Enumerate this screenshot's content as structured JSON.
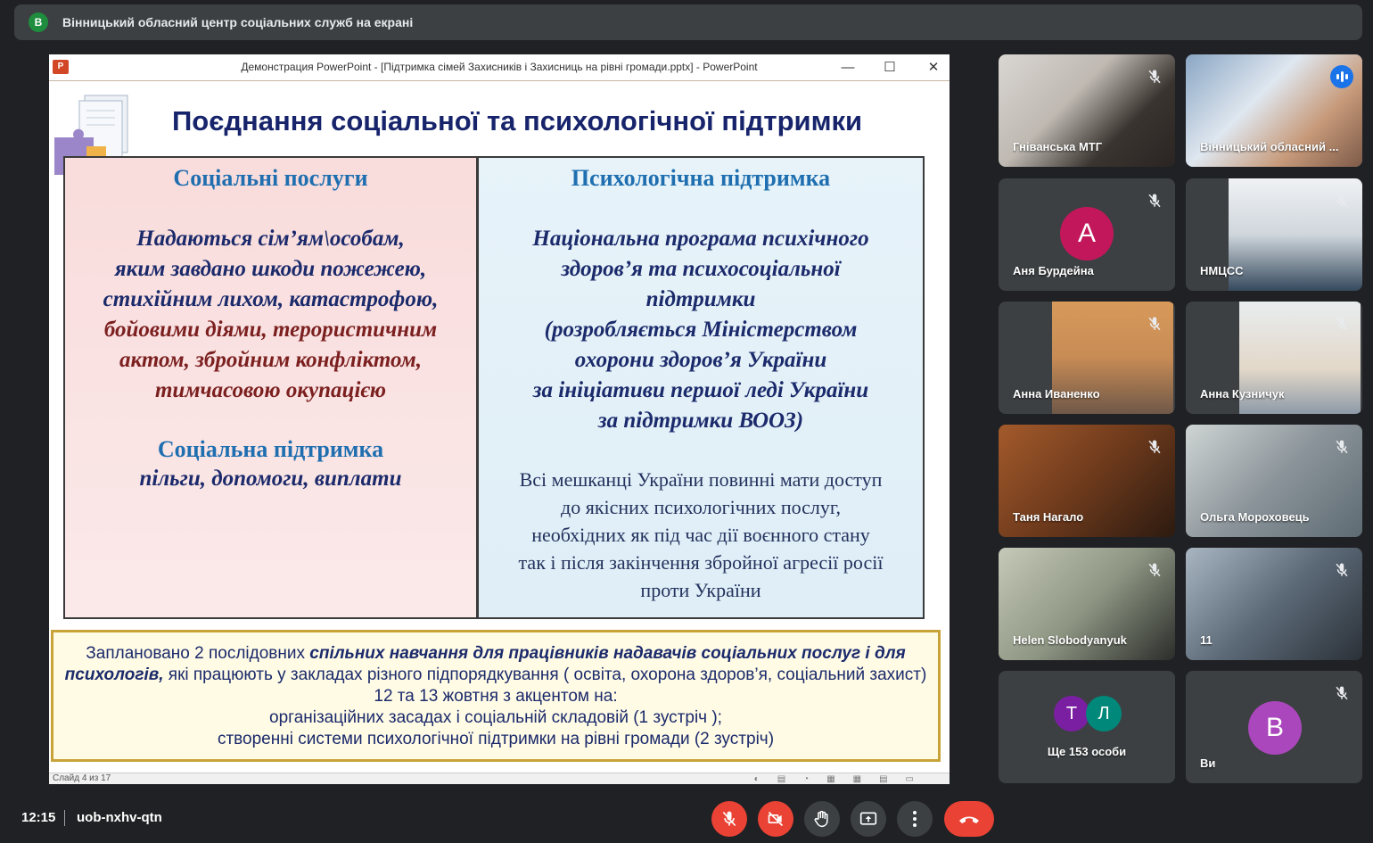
{
  "banner": {
    "avatar_letter": "В",
    "text": "Вінницький обласний центр соціальних служб на екрані"
  },
  "ppt_window": {
    "title": "Демонстрация PowerPoint - [Підтримка сімей  Захисників і Захисниць на рівні громади.pptx] - PowerPoint",
    "icon_label": "P",
    "minimize": "—",
    "maximize": "☐",
    "close": "✕"
  },
  "slide": {
    "title": "Поєднання соціальної та психологічної підтримки",
    "left": {
      "header": "Соціальні послуги",
      "line1": "Надаються сім’ям\\особам,",
      "line2": "яким завдано шкоди пожежею,",
      "line3": "стихійним лихом, катастрофою,",
      "line4": "бойовими діями, терористичним",
      "line5": "актом, збройним конфліктом,",
      "line6": "тимчасовою окупацією",
      "sub_header": "Соціальна підтримка",
      "sub_text": "пільги, допомоги, виплати"
    },
    "right": {
      "header": "Психологічна підтримка",
      "line1": "Національна програма психічного",
      "line2": "здоров’я та психосоціальної",
      "line3": "підтримки",
      "line4": "(розробляється  Міністерством",
      "line5": "охорони здоров’я України",
      "line6": "за ініціативи першої леді України",
      "line7": "за підтримки ВООЗ)",
      "plain1": "Всі мешканці України повинні мати доступ",
      "plain2": "до якісних психологічних послуг,",
      "plain3": "необхідних як під час  дії воєнного стану",
      "plain4": "так і після закінчення збройної агресії росії",
      "plain5": "проти України"
    },
    "bottom": {
      "part1": "Заплановано 2 послідовних ",
      "part2_bold": "спільних навчання для працівників надавачів соціальних послуг і для психологів,",
      "part3": " які працюють у закладах різного підпорядкування ( освіта, охорона здоров’я, соціальний захист)   12 та 13 жовтня з акцентом на:",
      "line4": "організаційних засадах  і соціальній складовій (1 зустріч );",
      "line5": "створенні системи психологічної підтримки на рівні громади  (2 зустріч)"
    }
  },
  "status_bar": {
    "slide_info": "Слайд 4 из 17"
  },
  "participants": [
    {
      "name": "Гніванська МТГ",
      "type": "video",
      "muted": true
    },
    {
      "name": "Вінницький обласний ...",
      "type": "video",
      "speaking": true
    },
    {
      "name": "Аня Бурдейна",
      "type": "avatar",
      "letter": "А",
      "color": "#c2185b",
      "muted": true
    },
    {
      "name": "НМЦСС",
      "type": "video",
      "muted": true
    },
    {
      "name": "Анна Иваненко",
      "type": "video",
      "muted": true
    },
    {
      "name": "Анна Кузничук",
      "type": "video",
      "muted": true
    },
    {
      "name": "Таня Нагало",
      "type": "video",
      "muted": true
    },
    {
      "name": "Ольга Мороховець",
      "type": "video",
      "muted": true
    },
    {
      "name": "Helen Slobodyanyuk",
      "type": "video",
      "muted": true
    },
    {
      "name": "11",
      "type": "video",
      "muted": true
    },
    {
      "name": "Ще 153 особи",
      "type": "group",
      "letters": [
        "Т",
        "Л"
      ],
      "colors": [
        "#7b1fa2",
        "#00897b"
      ]
    },
    {
      "name": "Ви",
      "type": "avatar",
      "letter": "В",
      "color": "#ab47bc",
      "muted": true
    }
  ],
  "bottom_bar": {
    "time": "12:15",
    "meeting_code": "uob-nxhv-qtn"
  },
  "colors": {
    "background": "#202124",
    "tile": "#3c4043",
    "danger": "#ea4335",
    "active_outline": "#8ab4f8"
  }
}
